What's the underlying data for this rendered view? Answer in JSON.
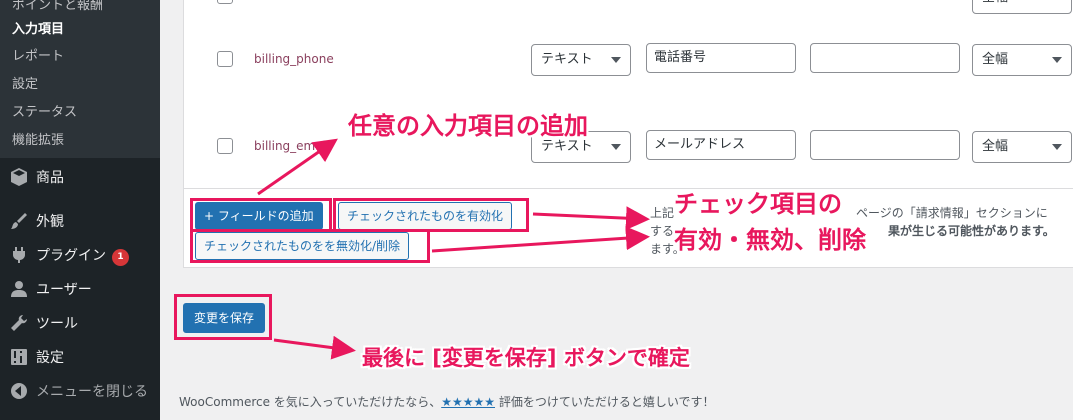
{
  "sidebar": {
    "submenu": [
      {
        "label": "ポイントと報酬",
        "current": false
      },
      {
        "label": "入力項目",
        "current": true
      },
      {
        "label": "レポート",
        "current": false
      },
      {
        "label": "設定",
        "current": false
      },
      {
        "label": "ステータス",
        "current": false
      },
      {
        "label": "機能拡張",
        "current": false
      }
    ],
    "menu": [
      {
        "label": "商品",
        "icon": "box-icon"
      },
      {
        "label": "外観",
        "icon": "paintbrush-icon"
      },
      {
        "label": "プラグイン",
        "icon": "plug-icon",
        "badge": "1"
      },
      {
        "label": "ユーザー",
        "icon": "user-icon"
      },
      {
        "label": "ツール",
        "icon": "wrench-icon"
      },
      {
        "label": "設定",
        "icon": "settings-icon"
      },
      {
        "label": "メニューを閉じる",
        "icon": "collapse-icon"
      }
    ]
  },
  "fields": [
    {
      "key": "billing_phone",
      "type": "テキスト",
      "label": "電話番号",
      "placeholder": "",
      "width": "全幅"
    },
    {
      "key": "billing_email",
      "type": "テキスト",
      "label": "メールアドレス",
      "placeholder": "",
      "width": "全幅"
    }
  ],
  "top_row_width": "全幅",
  "buttons": {
    "add_field": "+ フィールドの追加",
    "enable_checked": "チェックされたものを有効化",
    "disable_checked": "チェックされたものをを無効化/削除",
    "save": "変更を保存"
  },
  "notes": {
    "line1_left": "上記",
    "line1_right": "ページの「請求情報」セクションに",
    "line2_left": "する",
    "line2_right": "果が生じる可能性があります。",
    "line3": "ます。"
  },
  "annotations": {
    "add_item": "任意の入力項目の追加",
    "check_items_line1": "チェック項目の",
    "check_items_line2": "有効・無効、削除",
    "save_confirm": "最後に [変更を保存] ボタンで確定"
  },
  "footer": {
    "prefix": "WooCommerce を気に入っていただけたなら、",
    "stars": "★★★★★",
    "suffix": " 評価をつけていただけると嬉しいです！"
  },
  "colors": {
    "sidebar_bg": "#1d2327",
    "submenu_bg": "#2c3338",
    "primary": "#2271b1",
    "annotation": "#e8175d",
    "field_key": "#8a3f5d",
    "badge": "#d63638"
  }
}
